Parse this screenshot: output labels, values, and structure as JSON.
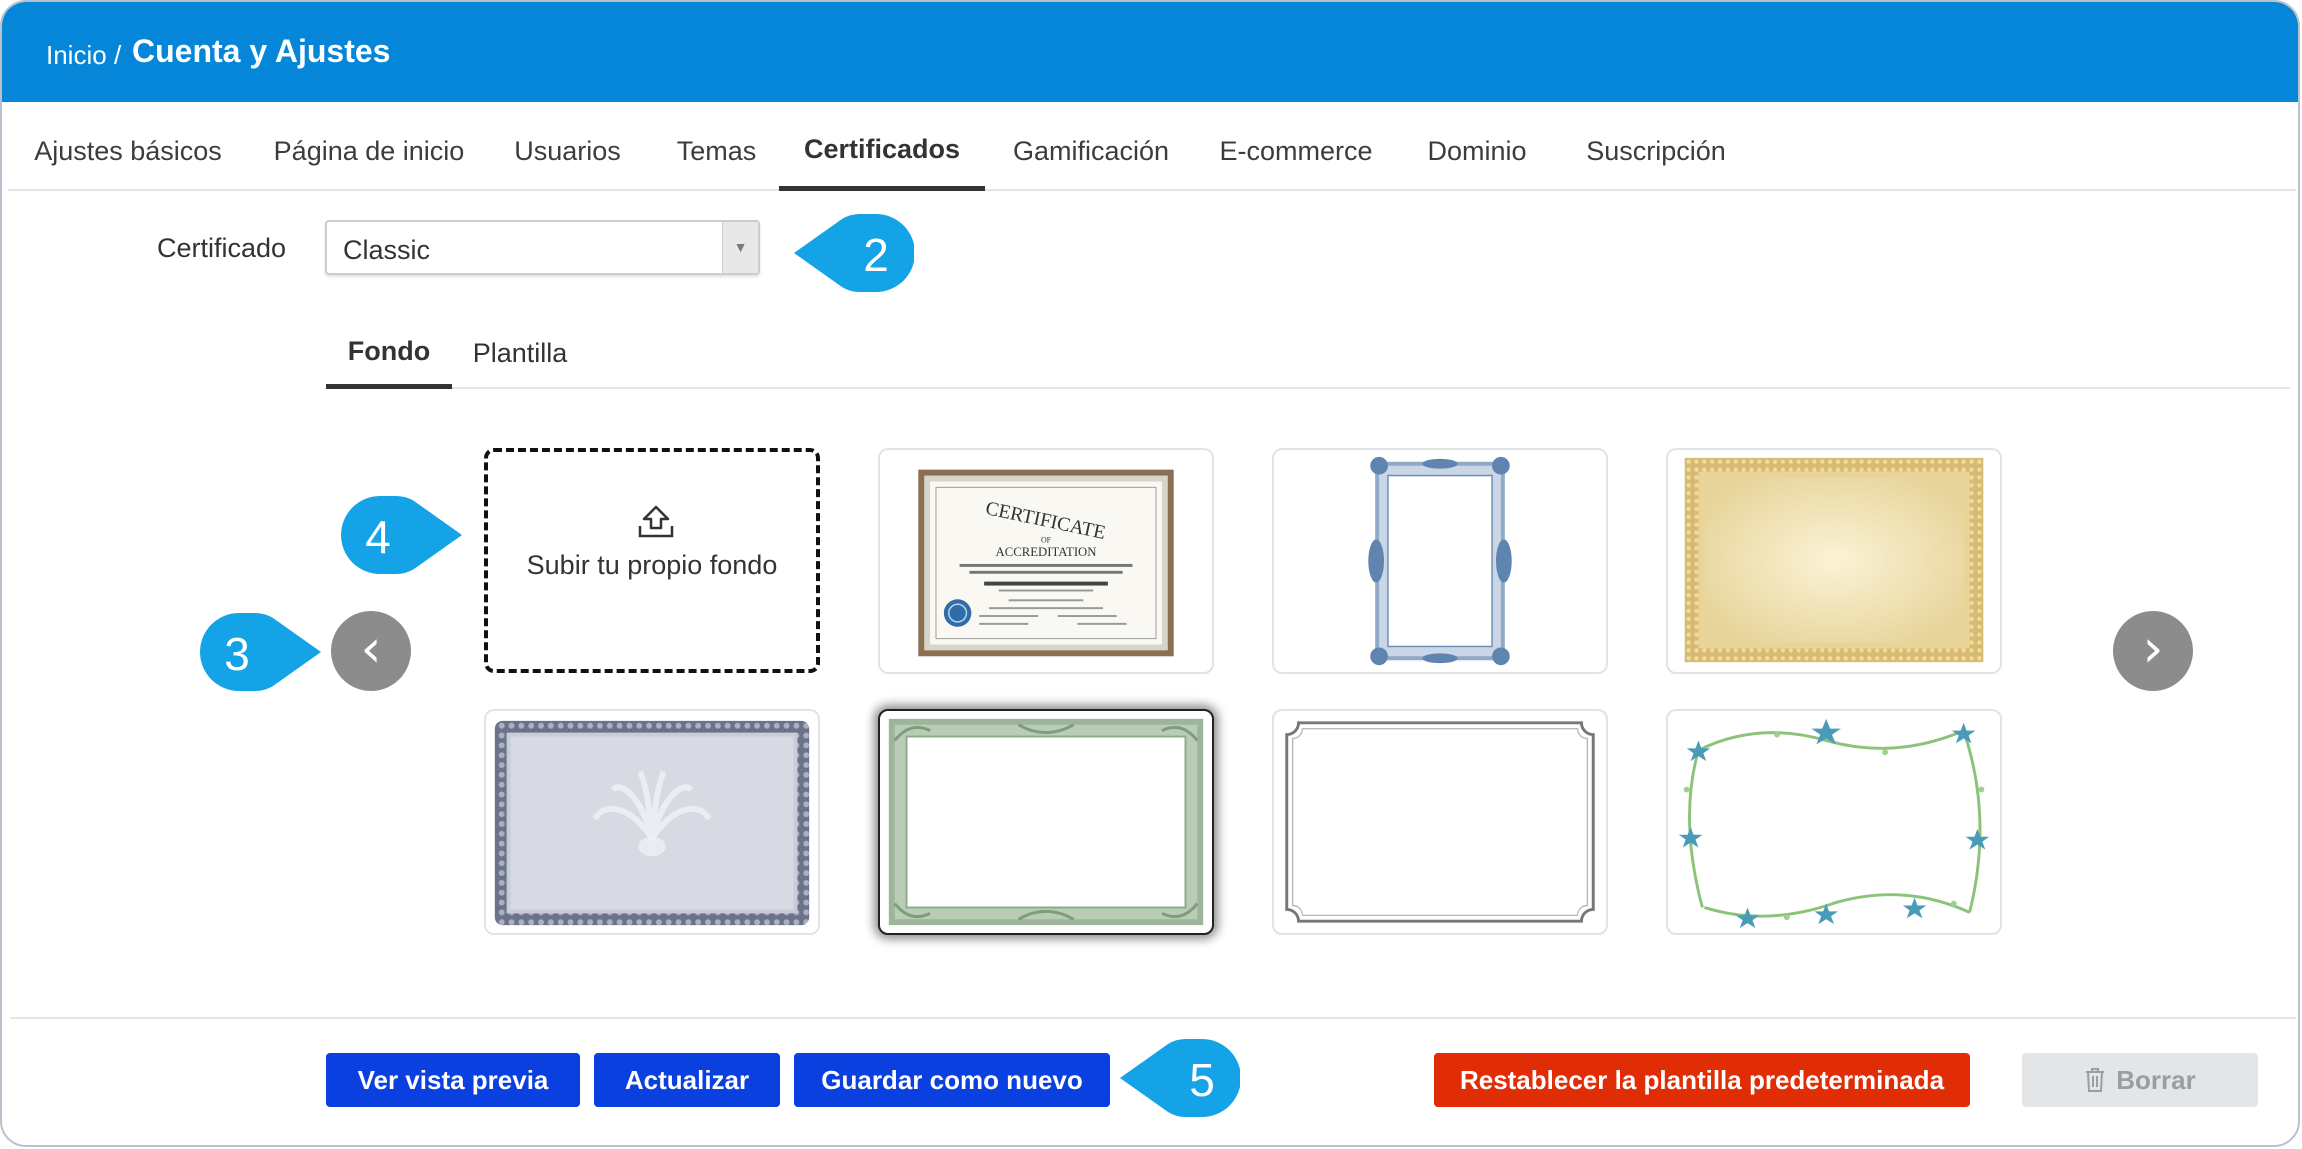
{
  "breadcrumb": {
    "root": "Inicio",
    "separator": "/",
    "current": "Cuenta y Ajustes"
  },
  "main_tabs": [
    {
      "label": "Ajustes básicos",
      "active": false
    },
    {
      "label": "Página de inicio",
      "active": false
    },
    {
      "label": "Usuarios",
      "active": false
    },
    {
      "label": "Temas",
      "active": false
    },
    {
      "label": "Certificados",
      "active": true
    },
    {
      "label": "Gamificación",
      "active": false
    },
    {
      "label": "E-commerce",
      "active": false
    },
    {
      "label": "Dominio",
      "active": false
    },
    {
      "label": "Suscripción",
      "active": false
    }
  ],
  "certificate": {
    "label": "Certificado",
    "selected": "Classic"
  },
  "sub_tabs": [
    {
      "label": "Fondo",
      "active": true
    },
    {
      "label": "Plantilla",
      "active": false
    }
  ],
  "gallery": {
    "upload_label": "Subir tu propio fondo",
    "selected_index": 4,
    "backgrounds": [
      {
        "name": "certificate-accreditation",
        "texts": [
          "CERTIFICATE",
          "OF",
          "ACCREDITATION"
        ]
      },
      {
        "name": "blue-ornate-portrait"
      },
      {
        "name": "gold-guilloche"
      },
      {
        "name": "gray-peacock"
      },
      {
        "name": "green-classic"
      },
      {
        "name": "simple-silver-frame"
      },
      {
        "name": "floral-stars"
      }
    ]
  },
  "callouts": [
    "2",
    "3",
    "4",
    "5"
  ],
  "actions": {
    "preview": "Ver vista previa",
    "update": "Actualizar",
    "save_new": "Guardar como nuevo",
    "reset": "Restablecer la plantilla predeterminada",
    "delete": "Borrar"
  },
  "colors": {
    "header": "#0586d9",
    "primary": "#0a3fe0",
    "danger": "#e02d06",
    "callout": "#14a3e6",
    "nav_arrow": "#8c8c8c"
  },
  "icons": {
    "upload": "upload-icon",
    "prev": "chevron-left-icon",
    "next": "chevron-right-icon",
    "delete": "trash-icon",
    "dropdown": "caret-down-icon"
  }
}
